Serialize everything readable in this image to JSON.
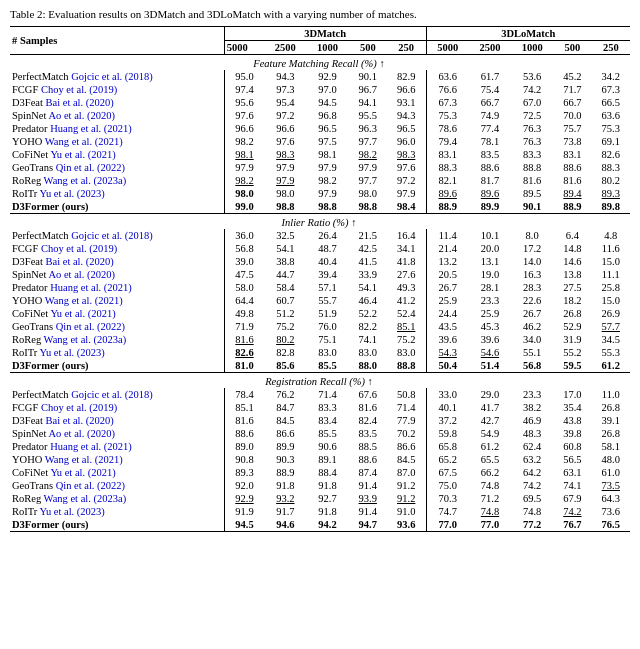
{
  "caption": "Table 2: Evaluation results on 3DMatch and 3DLoMatch with a varying number of matches.",
  "columns": {
    "samples": "# Samples",
    "threedmatch": "3DMatch",
    "threedlomatch": "3DLoMatch",
    "threedmatch_cols": [
      "5000",
      "2500",
      "1000",
      "500",
      "250"
    ],
    "threedlomatch_cols": [
      "5000",
      "2500",
      "1000",
      "500",
      "250"
    ]
  },
  "sections": [
    {
      "title": "Feature Matching Recall (%) ↑",
      "rows": [
        {
          "name": "PerfectMatch",
          "cite": "Gojcic et al. (2018)",
          "cite_color": "blue",
          "vals": [
            "95.0",
            "94.3",
            "92.9",
            "90.1",
            "82.9",
            "63.6",
            "61.7",
            "53.6",
            "45.2",
            "34.2"
          ]
        },
        {
          "name": "FCGF",
          "cite": "Choy et al. (2019)",
          "cite_color": "blue",
          "vals": [
            "97.4",
            "97.3",
            "97.0",
            "96.7",
            "96.6",
            "76.6",
            "75.4",
            "74.2",
            "71.7",
            "67.3"
          ]
        },
        {
          "name": "D3Feat",
          "cite": "Bai et al. (2020)",
          "cite_color": "blue",
          "vals": [
            "95.6",
            "95.4",
            "94.5",
            "94.1",
            "93.1",
            "67.3",
            "66.7",
            "67.0",
            "66.7",
            "66.5"
          ]
        },
        {
          "name": "SpinNet",
          "cite": "Ao et al. (2020)",
          "cite_color": "blue",
          "vals": [
            "97.6",
            "97.2",
            "96.8",
            "95.5",
            "94.3",
            "75.3",
            "74.9",
            "72.5",
            "70.0",
            "63.6"
          ]
        },
        {
          "name": "Predator",
          "cite": "Huang et al. (2021)",
          "cite_color": "blue",
          "vals": [
            "96.6",
            "96.6",
            "96.5",
            "96.3",
            "96.5",
            "78.6",
            "77.4",
            "76.3",
            "75.7",
            "75.3"
          ]
        },
        {
          "name": "YOHO",
          "cite": "Wang et al. (2021)",
          "cite_color": "blue",
          "vals": [
            "98.2",
            "97.6",
            "97.5",
            "97.7",
            "96.0",
            "79.4",
            "78.1",
            "76.3",
            "73.8",
            "69.1"
          ]
        },
        {
          "name": "CoFiNet",
          "cite": "Yu et al. (2021)",
          "cite_color": "blue",
          "ul_vals": [
            0,
            1,
            null,
            3,
            4
          ],
          "vals": [
            "98.1",
            "98.3",
            "98.1",
            "98.2",
            "98.3",
            "83.1",
            "83.5",
            "83.3",
            "83.1",
            "82.6"
          ]
        },
        {
          "name": "GeoTrans",
          "cite": "Qin et al. (2022)",
          "cite_color": "blue",
          "vals": [
            "97.9",
            "97.9",
            "97.9",
            "97.9",
            "97.6",
            "88.3",
            "88.6",
            "88.8",
            "88.6",
            "88.3"
          ]
        },
        {
          "name": "RoReg",
          "cite": "Wang et al. (2023a)",
          "cite_color": "blue",
          "ul_vals": [
            0,
            1
          ],
          "vals": [
            "98.2",
            "97.9",
            "98.2",
            "97.7",
            "97.2",
            "82.1",
            "81.7",
            "81.6",
            "81.6",
            "80.2"
          ]
        },
        {
          "name": "RoITr",
          "cite": "Yu et al. (2023)",
          "cite_color": "blue",
          "ul_vals": [
            5,
            6,
            null,
            8,
            null
          ],
          "vals": [
            "98.0",
            "98.0",
            "97.9",
            "98.0",
            "97.9",
            "89.6",
            "89.6",
            "89.5",
            "89.4",
            "89.3"
          ]
        },
        {
          "name": "D3Former",
          "cite": "(ours)",
          "cite_color": "",
          "bold": true,
          "vals": [
            "99.0",
            "98.8",
            "98.8",
            "98.8",
            "98.4",
            "88.9",
            "89.9",
            "90.1",
            "88.9",
            "89.8"
          ]
        }
      ]
    },
    {
      "title": "Inlier Ratio (%) ↑",
      "rows": [
        {
          "name": "PerfectMatch",
          "cite": "Gojcic et al. (2018)",
          "cite_color": "blue",
          "vals": [
            "36.0",
            "32.5",
            "26.4",
            "21.5",
            "16.4",
            "11.4",
            "10.1",
            "8.0",
            "6.4",
            "4.8"
          ]
        },
        {
          "name": "FCGF",
          "cite": "Choy et al. (2019)",
          "cite_color": "blue",
          "vals": [
            "56.8",
            "54.1",
            "48.7",
            "42.5",
            "34.1",
            "21.4",
            "20.0",
            "17.2",
            "14.8",
            "11.6"
          ]
        },
        {
          "name": "D3Feat",
          "cite": "Bai et al. (2020)",
          "cite_color": "blue",
          "vals": [
            "39.0",
            "38.8",
            "40.4",
            "41.5",
            "41.8",
            "13.2",
            "13.1",
            "14.0",
            "14.6",
            "15.0"
          ]
        },
        {
          "name": "SpinNet",
          "cite": "Ao et al. (2020)",
          "cite_color": "blue",
          "vals": [
            "47.5",
            "44.7",
            "39.4",
            "33.9",
            "27.6",
            "20.5",
            "19.0",
            "16.3",
            "13.8",
            "11.1"
          ]
        },
        {
          "name": "Predator",
          "cite": "Huang et al. (2021)",
          "cite_color": "blue",
          "vals": [
            "58.0",
            "58.4",
            "57.1",
            "54.1",
            "49.3",
            "26.7",
            "28.1",
            "28.3",
            "27.5",
            "25.8"
          ]
        },
        {
          "name": "YOHO",
          "cite": "Wang et al. (2021)",
          "cite_color": "blue",
          "vals": [
            "64.4",
            "60.7",
            "55.7",
            "46.4",
            "41.2",
            "25.9",
            "23.3",
            "22.6",
            "18.2",
            "15.0"
          ]
        },
        {
          "name": "CoFiNet",
          "cite": "Yu et al. (2021)",
          "cite_color": "blue",
          "vals": [
            "49.8",
            "51.2",
            "51.9",
            "52.2",
            "52.4",
            "24.4",
            "25.9",
            "26.7",
            "26.8",
            "26.9"
          ]
        },
        {
          "name": "GeoTrans",
          "cite": "Qin et al. (2022)",
          "cite_color": "blue",
          "ul_vals": [
            null,
            null,
            null,
            null,
            4
          ],
          "vals": [
            "71.9",
            "75.2",
            "76.0",
            "82.2",
            "85.1",
            "43.5",
            "45.3",
            "46.2",
            "52.9",
            "57.7"
          ]
        },
        {
          "name": "RoReg",
          "cite": "Wang et al. (2023a)",
          "cite_color": "blue",
          "ul_vals": [
            0,
            1
          ],
          "vals": [
            "81.6",
            "80.2",
            "75.1",
            "74.1",
            "75.2",
            "39.6",
            "39.6",
            "34.0",
            "31.9",
            "34.5"
          ]
        },
        {
          "name": "RoITr",
          "cite": "Yu et al. (2023)",
          "cite_color": "blue",
          "bold_vals": [
            0
          ],
          "ul_vals": [
            null,
            null,
            null,
            null,
            null,
            1,
            2
          ],
          "vals": [
            "82.6",
            "82.8",
            "83.0",
            "83.0",
            "83.0",
            "54.3",
            "54.6",
            "55.1",
            "55.2",
            "55.3"
          ]
        },
        {
          "name": "D3Former",
          "cite": "(ours)",
          "cite_color": "",
          "bold": true,
          "vals": [
            "81.0",
            "85.6",
            "85.5",
            "88.0",
            "88.8",
            "50.4",
            "51.4",
            "56.8",
            "59.5",
            "61.2"
          ]
        }
      ]
    },
    {
      "title": "Registration Recall (%) ↑",
      "rows": [
        {
          "name": "PerfectMatch",
          "cite": "Gojcic et al. (2018)",
          "cite_color": "blue",
          "vals": [
            "78.4",
            "76.2",
            "71.4",
            "67.6",
            "50.8",
            "33.0",
            "29.0",
            "23.3",
            "17.0",
            "11.0"
          ]
        },
        {
          "name": "FCGF",
          "cite": "Choy et al. (2019)",
          "cite_color": "blue",
          "vals": [
            "85.1",
            "84.7",
            "83.3",
            "81.6",
            "71.4",
            "40.1",
            "41.7",
            "38.2",
            "35.4",
            "26.8"
          ]
        },
        {
          "name": "D3Feat",
          "cite": "Bai et al. (2020)",
          "cite_color": "blue",
          "vals": [
            "81.6",
            "84.5",
            "83.4",
            "82.4",
            "77.9",
            "37.2",
            "42.7",
            "46.9",
            "43.8",
            "39.1"
          ]
        },
        {
          "name": "SpinNet",
          "cite": "Ao et al. (2020)",
          "cite_color": "blue",
          "vals": [
            "88.6",
            "86.6",
            "85.5",
            "83.5",
            "70.2",
            "59.8",
            "54.9",
            "48.3",
            "39.8",
            "26.8"
          ]
        },
        {
          "name": "Predator",
          "cite": "Huang et al. (2021)",
          "cite_color": "blue",
          "vals": [
            "89.0",
            "89.9",
            "90.6",
            "88.5",
            "86.6",
            "65.8",
            "61.2",
            "62.4",
            "60.8",
            "58.1"
          ]
        },
        {
          "name": "YOHO",
          "cite": "Wang et al. (2021)",
          "cite_color": "blue",
          "vals": [
            "90.8",
            "90.3",
            "89.1",
            "88.6",
            "84.5",
            "65.2",
            "65.5",
            "63.2",
            "56.5",
            "48.0"
          ]
        },
        {
          "name": "CoFiNet",
          "cite": "Yu et al. (2021)",
          "cite_color": "blue",
          "vals": [
            "89.3",
            "88.9",
            "88.4",
            "87.4",
            "87.0",
            "67.5",
            "66.2",
            "64.2",
            "63.1",
            "61.0"
          ]
        },
        {
          "name": "GeoTrans",
          "cite": "Qin et al. (2022)",
          "cite_color": "blue",
          "ul_vals": [
            null,
            null,
            null,
            null,
            5
          ],
          "vals": [
            "92.0",
            "91.8",
            "91.8",
            "91.4",
            "91.2",
            "75.0",
            "74.8",
            "74.2",
            "74.1",
            "73.5"
          ]
        },
        {
          "name": "RoReg",
          "cite": "Wang et al. (2023a)",
          "cite_color": "blue",
          "ul_vals": [
            0,
            1,
            null,
            3,
            4
          ],
          "vals": [
            "92.9",
            "93.2",
            "92.7",
            "93.9",
            "91.2",
            "70.3",
            "71.2",
            "69.5",
            "67.9",
            "64.3"
          ]
        },
        {
          "name": "RoITr",
          "cite": "Yu et al. (2023)",
          "cite_color": "blue",
          "ul_vals": [
            null,
            null,
            null,
            null,
            null,
            null,
            6,
            null,
            8,
            null
          ],
          "vals": [
            "91.9",
            "91.7",
            "91.8",
            "91.4",
            "91.0",
            "74.7",
            "74.8",
            "74.8",
            "74.2",
            "73.6"
          ]
        },
        {
          "name": "D3Former",
          "cite": "(ours)",
          "cite_color": "",
          "bold": true,
          "vals": [
            "94.5",
            "94.6",
            "94.2",
            "94.7",
            "93.6",
            "77.0",
            "77.0",
            "77.2",
            "76.7",
            "76.5"
          ]
        }
      ]
    }
  ]
}
